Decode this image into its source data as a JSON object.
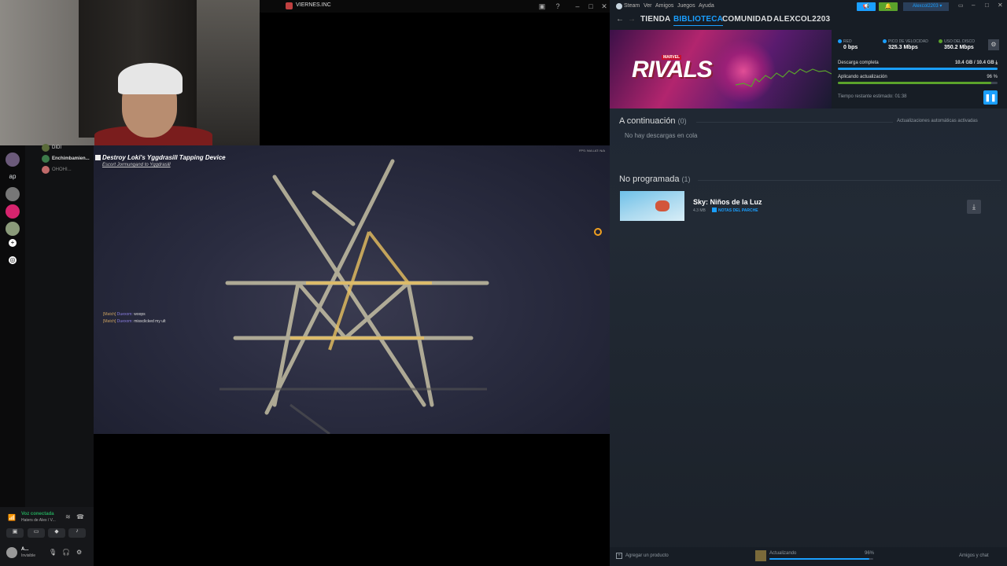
{
  "game_window": {
    "title": "VIERNES.INC"
  },
  "discord": {
    "servers": [
      "ap"
    ],
    "members": [
      {
        "name": "DIDI"
      },
      {
        "name": "Enchimbamien..."
      },
      {
        "name": "OHOHI..."
      }
    ],
    "voice_status": "Voz conectada",
    "voice_channel": "Haters de Alex / V...",
    "user_name": "A...",
    "user_status": "Invisible"
  },
  "game": {
    "quest_title": "Destroy Loki's Yggdrasill Tapping Device",
    "quest_sub": "Escort Jormungand to Yggdrasill",
    "chat": [
      {
        "channel": "[Match]",
        "name": "Duexom:",
        "text": "woops"
      },
      {
        "channel": "[Match]",
        "name": "Duexom:",
        "text": "missclicked my ult"
      }
    ],
    "fps_label": "FPS: N/A     LAT: N/A"
  },
  "steam": {
    "menu": [
      "Steam",
      "Ver",
      "Amigos",
      "Juegos",
      "Ayuda"
    ],
    "account_button": "Alexcol2203",
    "nav": [
      "TIENDA",
      "BIBLIOTECA",
      "COMUNIDAD",
      "ALEXCOL2203"
    ],
    "nav_active": 1,
    "banner": {
      "logo": "RIVALS",
      "badge": "MARVEL"
    },
    "stats": [
      {
        "label": "RED",
        "value": "0 bps",
        "color": "#1a9fff"
      },
      {
        "label": "PICO DE VELOCIDAD",
        "value": "325.3 Mbps",
        "color": "#1a9fff"
      },
      {
        "label": "USO DEL DISCO",
        "value": "350.2 Mbps",
        "color": "#5ba32b"
      }
    ],
    "download_complete_label": "Descarga completa",
    "download_complete_value": "10.4 GB / 10.4 GB",
    "download_complete_progress": 1.0,
    "apply_update_label": "Aplicando actualización",
    "apply_update_value": "96 %",
    "apply_update_progress": 0.96,
    "time_remaining": "Tiempo restante estimado: 01:38",
    "queue_title": "A continuación",
    "queue_count": "(0)",
    "auto_updates": "Actualizaciones automáticas activadas",
    "queue_empty": "No hay descargas en cola",
    "unscheduled_title": "No programada",
    "unscheduled_count": "(1)",
    "unscheduled_items": [
      {
        "name": "Sky: Niños de la Luz",
        "size": "4.3 MB",
        "notes": "NOTAS DEL PARCHE"
      }
    ],
    "add_product": "Agregar un producto",
    "footer_status": "Actualizando",
    "footer_percent": "96%",
    "footer_progress": 0.96,
    "friends_chat": "Amigos y chat"
  }
}
